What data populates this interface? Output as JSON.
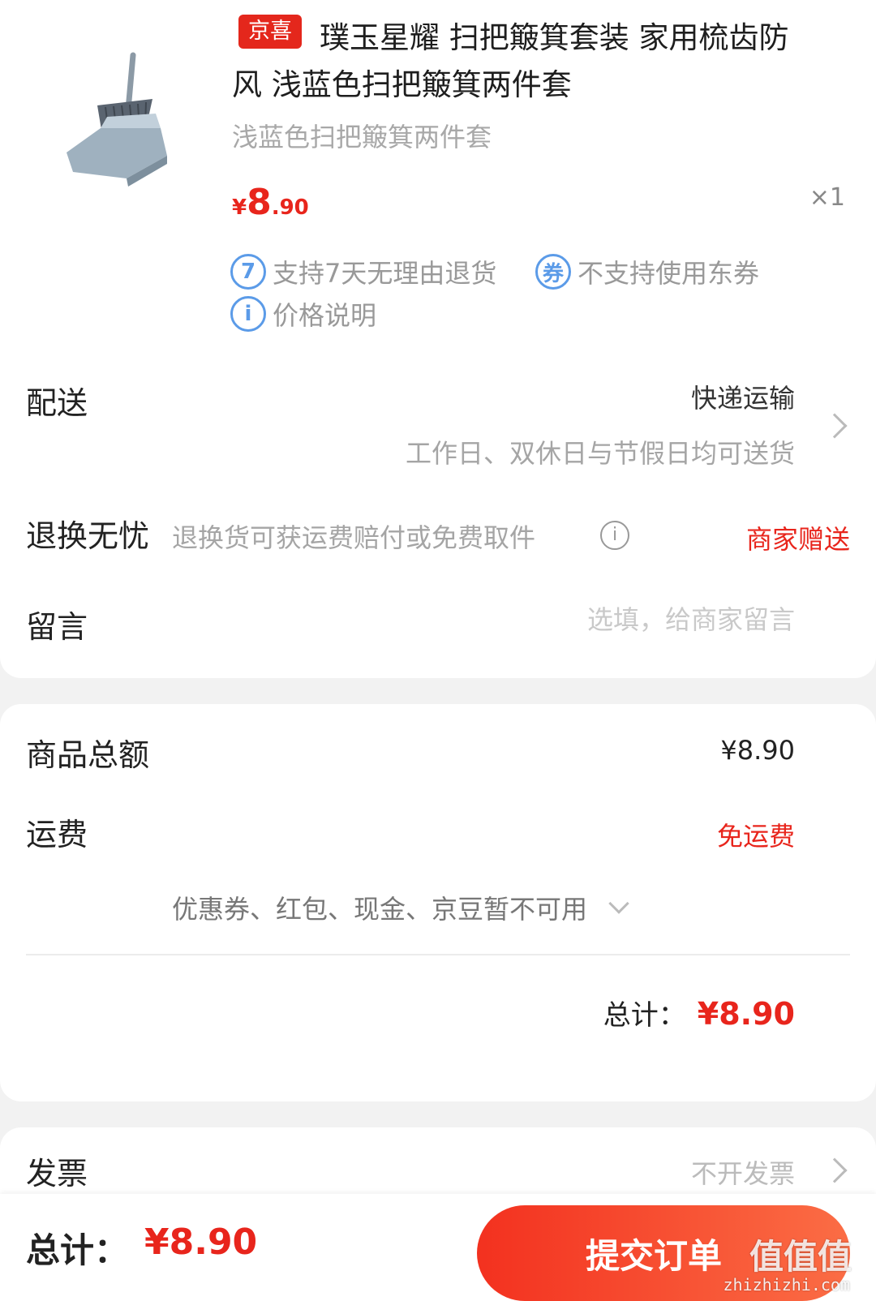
{
  "product": {
    "tag": "京喜",
    "title_line1": "璞玉星耀 扫把簸箕套装 家用梳齿防",
    "title_line2": "风 浅蓝色扫把簸箕两件套",
    "sku": "浅蓝色扫把簸箕两件套",
    "price_currency": "¥",
    "price_int": "8",
    "price_dec": ".90",
    "qty": "×1",
    "image_icon": "broom-dustpan-icon",
    "badges": [
      {
        "icon": "7",
        "icon_name": "seven-day-return-icon",
        "text": "支持7天无理由退货"
      },
      {
        "icon": "券",
        "icon_name": "coupon-icon",
        "text": "不支持使用东券"
      },
      {
        "icon": "i",
        "icon_name": "info-icon",
        "text": "价格说明"
      }
    ]
  },
  "delivery": {
    "label": "配送",
    "method": "快递运输",
    "sub": "工作日、双休日与节假日均可送货"
  },
  "returns": {
    "label": "退换无忧",
    "desc": "退换货可获运费赔付或免费取件",
    "info_icon": "i",
    "gift": "商家赠送"
  },
  "message": {
    "label": "留言",
    "placeholder": "选填，给商家留言"
  },
  "summary": {
    "goods_label": "商品总额",
    "goods_value": "¥8.90",
    "shipping_label": "运费",
    "shipping_value": "免运费",
    "coupon_text": "优惠券、红包、现金、京豆暂不可用",
    "total_label": "总计：",
    "total_value": "¥8.90"
  },
  "invoice": {
    "label": "发票",
    "value": "不开发票"
  },
  "bottom_bar": {
    "total_label": "总计：",
    "total_value": "¥8.90",
    "submit_label": "提交订单"
  },
  "watermark": {
    "text": "值值值",
    "sub": "zhizhizhi.com"
  },
  "colors": {
    "accent": "#e8251c",
    "badge_blue": "#5b9be8",
    "submit_gradient_start": "#f3311f",
    "submit_gradient_end": "#fb6d45"
  }
}
